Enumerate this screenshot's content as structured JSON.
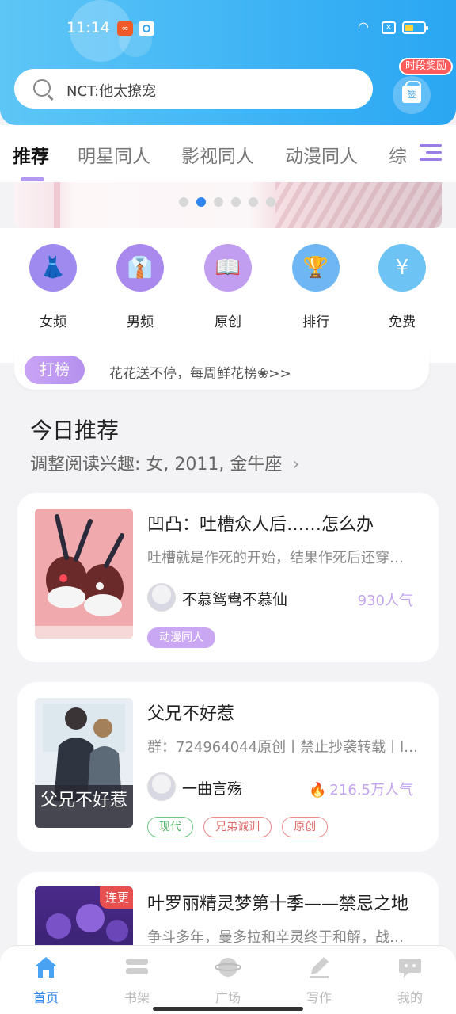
{
  "status": {
    "time": "11:14"
  },
  "search": {
    "placeholder": "NCT:他太撩宠"
  },
  "gift": {
    "badge": "时段奖励",
    "icon_text": "签"
  },
  "tabs": [
    "推荐",
    "明星同人",
    "影视同人",
    "动漫同人",
    "综"
  ],
  "banner": {
    "active_dot": 1,
    "dot_count": 6
  },
  "categories": [
    {
      "label": "女频",
      "icon": "dress-icon",
      "color": "#9f8af0"
    },
    {
      "label": "男频",
      "icon": "shirt-icon",
      "color": "#a989ee"
    },
    {
      "label": "原创",
      "icon": "book-icon",
      "color": "#c29ef0"
    },
    {
      "label": "排行",
      "icon": "trophy-icon",
      "color": "#6fb6f5"
    },
    {
      "label": "免费",
      "icon": "coin-icon",
      "color": "#6cc3f4"
    }
  ],
  "ranking": {
    "badge": "打榜",
    "text": "花花送不停，每周鲜花榜❀>>"
  },
  "section": {
    "title": "今日推荐",
    "subtitle": "调整阅读兴趣: 女, 2011, 金牛座",
    "chevron": "›"
  },
  "books": [
    {
      "title": "凹凸：吐槽众人后……怎么办",
      "desc": "吐槽就是作死的开始，结果作死后还穿…",
      "author": "不慕鸳鸯不慕仙",
      "popularity": "930人气",
      "flame": false,
      "tags": [
        {
          "label": "动漫同人",
          "style": "filled"
        }
      ]
    },
    {
      "title": "父兄不好惹",
      "desc": "群：724964044原创丨禁止抄袭转载丨l…",
      "author": "一曲言殇",
      "popularity": "216.5万人气",
      "flame": true,
      "cover_text": "父兄不好惹",
      "tags": [
        {
          "label": "现代",
          "style": "green"
        },
        {
          "label": "兄弟诚训",
          "style": "red"
        },
        {
          "label": "原创",
          "style": "red"
        }
      ]
    },
    {
      "title": "叶罗丽精灵梦第十季——禁忌之地",
      "desc": "争斗多年，曼多拉和辛灵终于和解，战…",
      "badge": "连更"
    }
  ],
  "bottom_nav": [
    {
      "label": "首页",
      "icon": "home-icon",
      "active": true
    },
    {
      "label": "书架",
      "icon": "bookshelf-icon",
      "active": false
    },
    {
      "label": "广场",
      "icon": "planet-icon",
      "active": false
    },
    {
      "label": "写作",
      "icon": "pen-icon",
      "active": false
    },
    {
      "label": "我的",
      "icon": "chat-icon",
      "active": false
    }
  ],
  "colors": {
    "header": "#3db3f5",
    "accent": "#b39af0",
    "active_nav": "#2f86ef"
  }
}
